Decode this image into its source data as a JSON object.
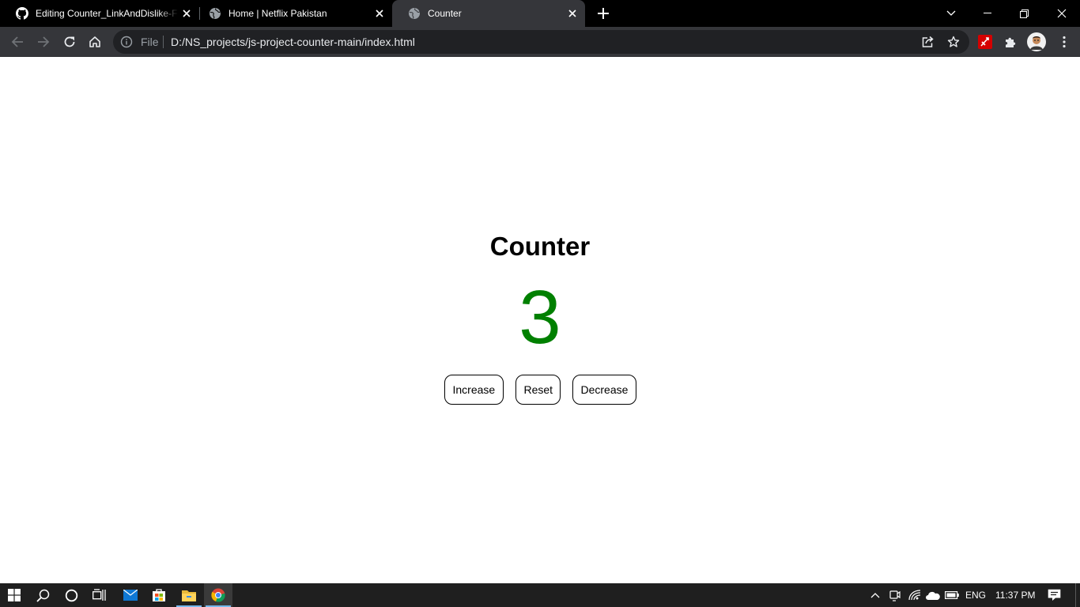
{
  "browser": {
    "tabs": [
      {
        "title": "Editing Counter_LinkAndDislike-F",
        "favicon": "github-icon",
        "active": false
      },
      {
        "title": "Home | Netflix Pakistan",
        "favicon": "globe-icon",
        "active": false
      },
      {
        "title": "Counter",
        "favicon": "globe-icon",
        "active": true
      }
    ],
    "omnibox": {
      "scheme_label": "File",
      "url": "D:/NS_projects/js-project-counter-main/index.html"
    }
  },
  "page": {
    "title": "Counter",
    "count": "3",
    "count_color": "#008000",
    "buttons": {
      "increase": "Increase",
      "reset": "Reset",
      "decrease": "Decrease"
    }
  },
  "taskbar": {
    "language": "ENG",
    "time": "11:37 PM",
    "pinned": [
      "windows-start-icon",
      "search-icon",
      "cortana-icon",
      "task-view-icon",
      "mail-icon",
      "store-icon",
      "file-explorer-icon",
      "chrome-icon"
    ]
  },
  "colors": {
    "tabstrip": "#000000",
    "toolbar": "#35363a",
    "omnibox": "#202124",
    "taskbar": "#1f1f1f"
  }
}
